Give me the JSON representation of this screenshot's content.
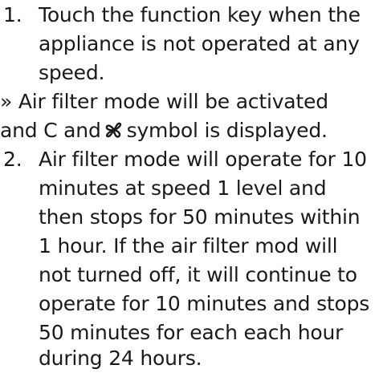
{
  "instructions": {
    "step1": {
      "number": "1.",
      "lines": [
        "Touch the function key when the",
        "appliance is not operated at any",
        "speed."
      ]
    },
    "result": {
      "line1": "» Air filter mode will be activated",
      "line2_before": "and C and",
      "line2_after": "symbol is displayed.",
      "symbol_icon": "fan-icon"
    },
    "step2": {
      "number": "2.",
      "lines": [
        "Air filter mode will operate for 10",
        "minutes at speed 1 level and",
        "then stops for 50 minutes within",
        "1 hour. If the air filter mod will",
        "not turned off, it will continue to",
        "operate for 10 minutes and stops",
        "50 minutes for each each hour",
        "during 24 hours."
      ]
    }
  }
}
